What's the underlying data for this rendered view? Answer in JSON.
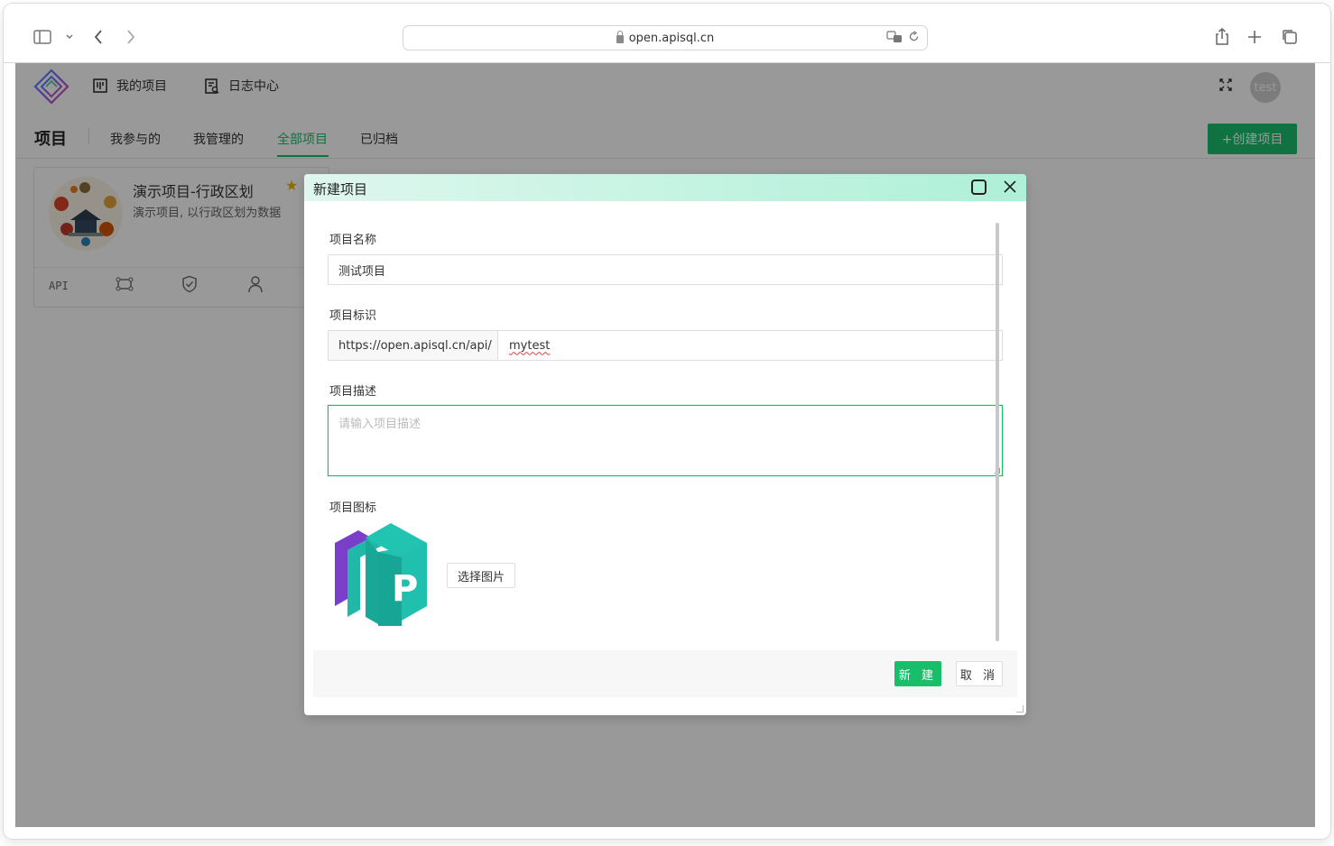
{
  "browser": {
    "url": "open.apisql.cn"
  },
  "app": {
    "nav": {
      "my_projects": "我的项目",
      "log_center": "日志中心"
    },
    "avatar_text": "test",
    "page_title": "项目",
    "tabs": [
      {
        "label": "我参与的",
        "active": false
      },
      {
        "label": "我管理的",
        "active": false
      },
      {
        "label": "全部项目",
        "active": true
      },
      {
        "label": "已归档",
        "active": false
      }
    ],
    "create_button": "+创建项目",
    "card": {
      "title": "演示项目-行政区划",
      "description": "演示项目, 以行政区划为数据",
      "footer_api": "API"
    },
    "accent_color": "#19be6b"
  },
  "modal": {
    "title": "新建项目",
    "name_label": "项目名称",
    "name_value": "测试项目",
    "ident_label": "项目标识",
    "ident_prefix": "https://open.apisql.cn/api/",
    "ident_value": "mytest",
    "desc_label": "项目描述",
    "desc_placeholder": "请输入项目描述",
    "icon_label": "项目图标",
    "icon_letter": "P",
    "choose_image": "选择图片",
    "ok_button": "新 建",
    "cancel_button": "取 消"
  }
}
